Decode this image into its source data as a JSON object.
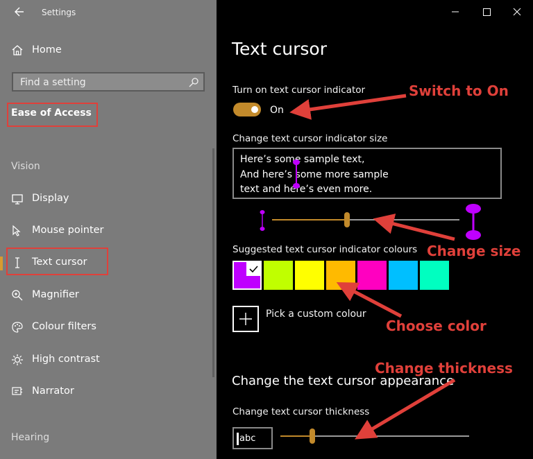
{
  "sidebar": {
    "app_title": "Settings",
    "home_label": "Home",
    "search_placeholder": "Find a setting",
    "category_label": "Ease of Access",
    "section_vision": "Vision",
    "section_hearing": "Hearing",
    "items": [
      {
        "label": "Display",
        "icon": "monitor-icon"
      },
      {
        "label": "Mouse pointer",
        "icon": "mouse-pointer-icon"
      },
      {
        "label": "Text cursor",
        "icon": "text-cursor-icon",
        "selected": true
      },
      {
        "label": "Magnifier",
        "icon": "magnifier-icon"
      },
      {
        "label": "Colour filters",
        "icon": "colour-filters-icon"
      },
      {
        "label": "High contrast",
        "icon": "high-contrast-icon"
      },
      {
        "label": "Narrator",
        "icon": "narrator-icon"
      }
    ]
  },
  "main": {
    "title": "Text cursor",
    "indicator_toggle_label": "Turn on text cursor indicator",
    "indicator_toggle_state": "On",
    "size_label": "Change text cursor indicator size",
    "sample_lines": [
      "Here’s some sample text,",
      "And here’s some more sample",
      "text and here’s even more."
    ],
    "size_slider_value": 0.4,
    "colours_label": "Suggested text cursor indicator colours",
    "colours": [
      "#bf00ff",
      "#c0ff00",
      "#ffff00",
      "#ffba00",
      "#ff00c0",
      "#00bfff",
      "#00ffc0"
    ],
    "selected_colour_index": 0,
    "custom_colour_label": "Pick a custom colour",
    "appearance_heading": "Change the text cursor appearance",
    "thickness_label": "Change text cursor thickness",
    "thickness_preview_text": "abc",
    "thickness_slider_value": 0.17
  },
  "annotations": {
    "switch_on": "Switch to On",
    "change_size": "Change size",
    "choose_color": "Choose color",
    "change_thickness": "Change thickness"
  },
  "colors": {
    "accent": "#c28a2b",
    "sidebar_bg": "#7b7b7b",
    "annotation": "#e0403a",
    "indicator": "#bf00ff"
  }
}
